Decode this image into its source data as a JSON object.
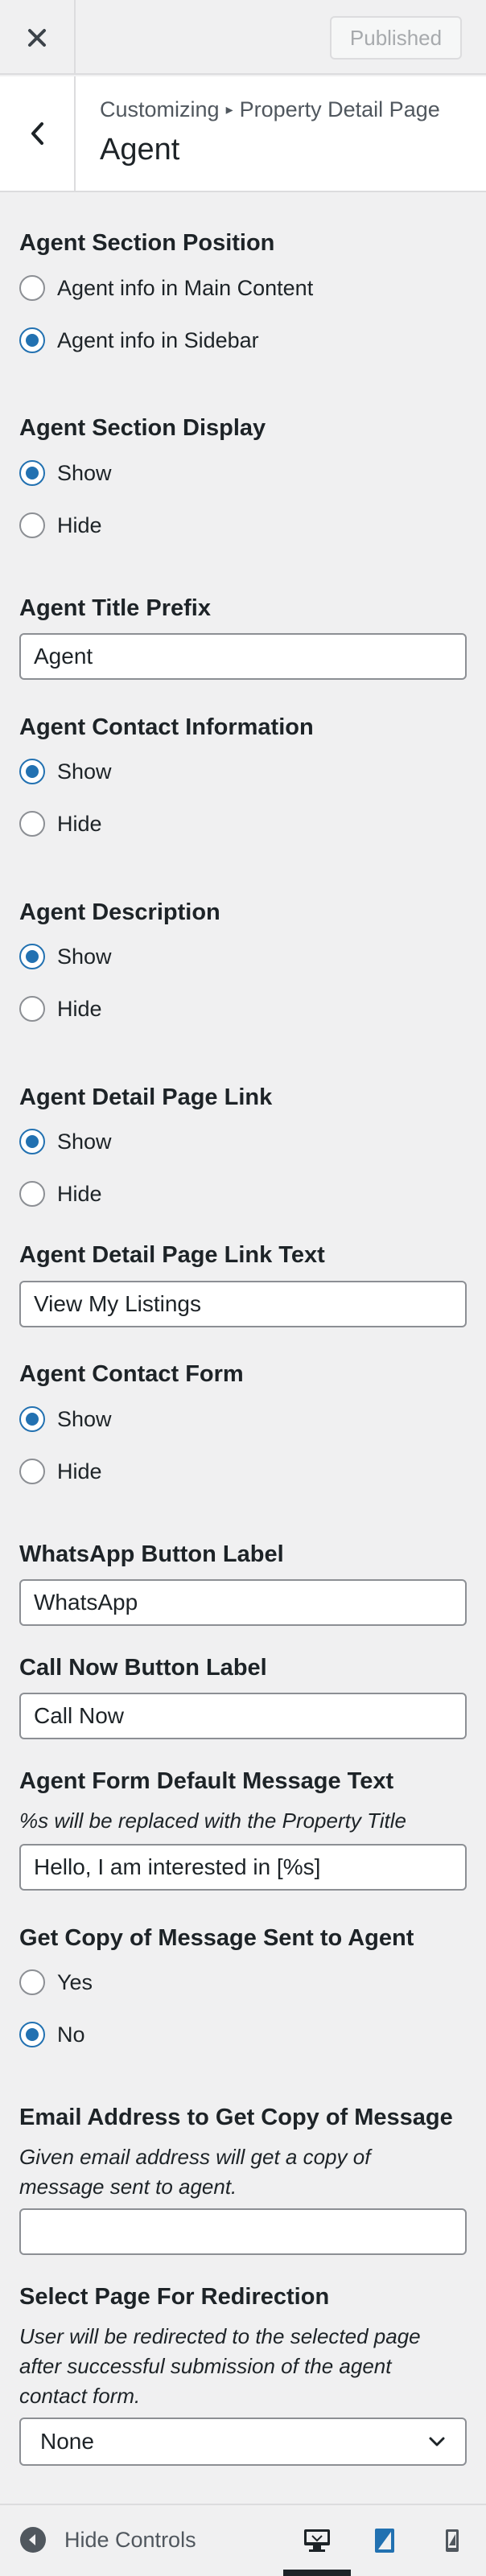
{
  "header": {
    "publish_label": "Published"
  },
  "section": {
    "breadcrumb_prefix": "Customizing",
    "breadcrumb_parent": "Property Detail Page",
    "title": "Agent"
  },
  "controls": {
    "agent_section_position": {
      "title": "Agent Section Position",
      "options": [
        "Agent info in Main Content",
        "Agent info in Sidebar"
      ],
      "selected": "Agent info in Sidebar"
    },
    "agent_section_display": {
      "title": "Agent Section Display",
      "options": [
        "Show",
        "Hide"
      ],
      "selected": "Show"
    },
    "agent_title_prefix": {
      "title": "Agent Title Prefix",
      "value": "Agent"
    },
    "agent_contact_information": {
      "title": "Agent Contact Information",
      "options": [
        "Show",
        "Hide"
      ],
      "selected": "Show"
    },
    "agent_description": {
      "title": "Agent Description",
      "options": [
        "Show",
        "Hide"
      ],
      "selected": "Show"
    },
    "agent_detail_page_link": {
      "title": "Agent Detail Page Link",
      "options": [
        "Show",
        "Hide"
      ],
      "selected": "Show"
    },
    "agent_detail_page_link_text": {
      "title": "Agent Detail Page Link Text",
      "value": "View My Listings"
    },
    "agent_contact_form": {
      "title": "Agent Contact Form",
      "options": [
        "Show",
        "Hide"
      ],
      "selected": "Show"
    },
    "whatsapp_button_label": {
      "title": "WhatsApp Button Label",
      "value": "WhatsApp"
    },
    "call_now_button_label": {
      "title": "Call Now Button Label",
      "value": "Call Now"
    },
    "agent_form_default_message": {
      "title": "Agent Form Default Message Text",
      "description": "%s will be replaced with the Property Title",
      "value": "Hello, I am interested in [%s]"
    },
    "get_copy_of_message": {
      "title": "Get Copy of Message Sent to Agent",
      "options": [
        "Yes",
        "No"
      ],
      "selected": "No"
    },
    "email_copy_address": {
      "title": "Email Address to Get Copy of Message",
      "description_line1": "Given email address will get a copy of",
      "description_line2": "message sent to agent.",
      "value": ""
    },
    "select_page_redirection": {
      "title": "Select Page For Redirection",
      "description_line1": "User will be redirected to the selected page",
      "description_line2": "after successful submission of the agent",
      "description_line3": "contact form.",
      "selected": "None"
    }
  },
  "footer": {
    "hide_controls_label": "Hide Controls",
    "active_device": "desktop"
  },
  "colors": {
    "accent": "#2271b1",
    "background": "#f0f0f1",
    "border": "#8c8f94",
    "muted": "#a7aaad"
  }
}
